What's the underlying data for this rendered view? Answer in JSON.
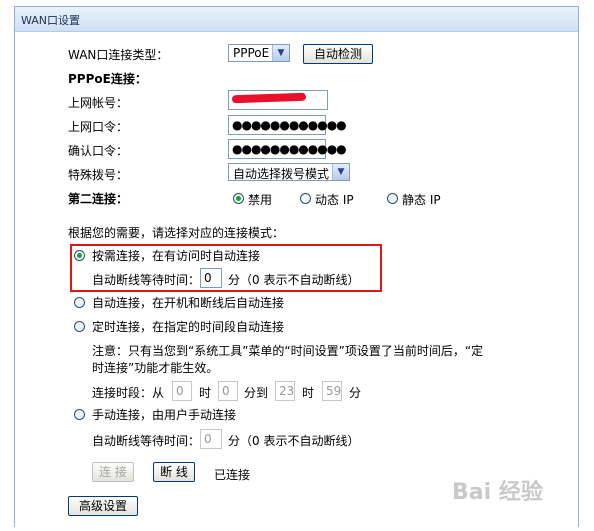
{
  "window": {
    "title": "WAN口设置"
  },
  "form": {
    "conn_type_label": "WAN口连接类型：",
    "conn_type_value": "PPPoE",
    "auto_detect_button": "自动检测",
    "pppoe_heading": "PPPoE连接：",
    "account_label": "上网帐号：",
    "password_label": "上网口令：",
    "password_dots": "●●●●●●●●●●●●",
    "confirm_label": "确认口令：",
    "confirm_dots": "●●●●●●●●●●●●",
    "special_dial_label": "特殊拨号：",
    "special_dial_value": "自动选择拨号模式",
    "second_conn_label": "第二连接：",
    "second_options": [
      "禁用",
      "动态 IP",
      "静态 IP"
    ],
    "mode_prompt": "根据您的需要，请选择对应的连接模式：",
    "mode_on_demand": "按需连接，在有访问时自动连接",
    "idle_wait_label": "自动断线等待时间：",
    "idle_wait_value": "0",
    "idle_unit_hint": "分（0 表示不自动断线）",
    "mode_auto": "自动连接，在开机和断线后自动连接",
    "mode_timed": "定时连接，在指定的时间段自动连接",
    "note_line1": "注意：只有当您到“系统工具”菜单的“时间设置”项设置了当前时间后，“定",
    "note_line2": "时连接”功能才能生效。",
    "period_label": "连接时段：从",
    "period_from_h": "0",
    "hour_unit": "时",
    "period_from_m": "0",
    "to_label": "分到",
    "period_to_h": "23",
    "period_to_m": "59",
    "minute_unit": "分",
    "mode_manual": "手动连接，由用户手动连接",
    "manual_idle_label": "自动断线等待时间：",
    "manual_idle_value": "0",
    "manual_idle_hint": "分（0 表示不自动断线）",
    "connect_button": "连 接",
    "disconnect_button": "断 线",
    "status_text": "已连接",
    "advanced_button": "高级设置"
  },
  "watermark": "Bai 经验"
}
